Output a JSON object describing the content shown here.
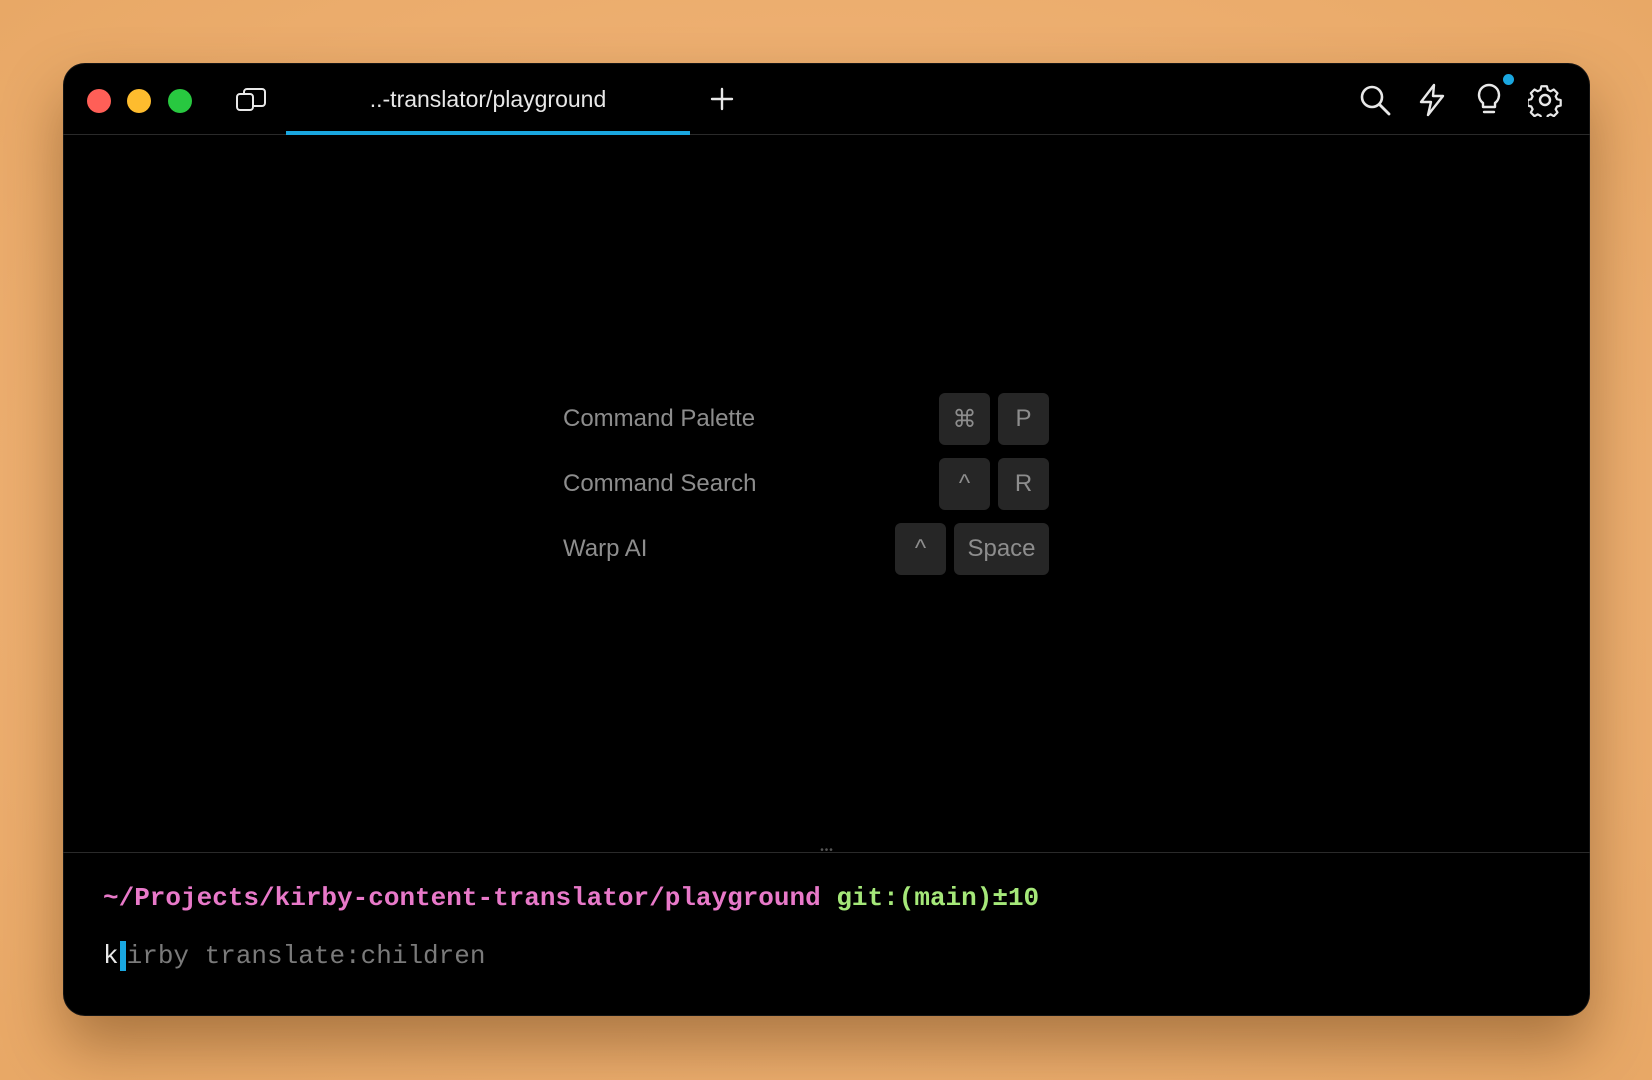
{
  "window": {
    "tab": {
      "label": "..-translator/playground"
    },
    "toolbar_icons": [
      "search-icon",
      "bolt-icon",
      "lightbulb-icon",
      "gear-icon"
    ]
  },
  "shortcuts": [
    {
      "label": "Command Palette",
      "keys": [
        "⌘",
        "P"
      ]
    },
    {
      "label": "Command Search",
      "keys": [
        "^",
        "R"
      ]
    },
    {
      "label": "Warp AI",
      "keys": [
        "^",
        "Space"
      ]
    }
  ],
  "terminal": {
    "path": "~/Projects/kirby-content-translator/playground",
    "git": "git:(main)±10",
    "typed": "k",
    "suggestion": "irby translate:children"
  },
  "colors": {
    "accent": "#1aa7e0",
    "path": "#e879c9",
    "git": "#a5e879"
  }
}
